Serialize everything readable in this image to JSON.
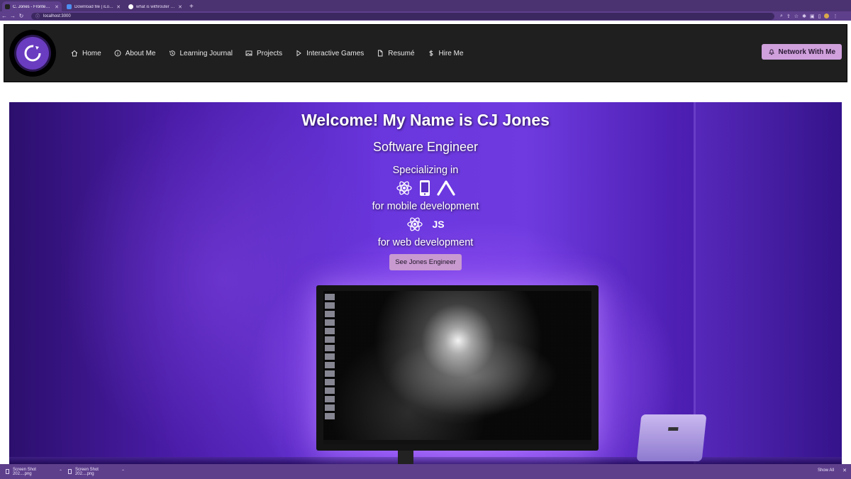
{
  "browser": {
    "tabs": [
      {
        "label": "C. Jones - Frontend & Fullstack Developer",
        "active": true
      },
      {
        "label": "Download file | iLoveIMG",
        "active": false
      },
      {
        "label": "what is withrouter - Google Search",
        "active": false
      }
    ],
    "url": "localhost:3000"
  },
  "site": {
    "nav": {
      "items": [
        {
          "label": "Home",
          "icon": "home-icon"
        },
        {
          "label": "About Me",
          "icon": "info-icon"
        },
        {
          "label": "Learning Journal",
          "icon": "history-icon"
        },
        {
          "label": "Projects",
          "icon": "image-icon"
        },
        {
          "label": "Interactive Games",
          "icon": "play-icon"
        },
        {
          "label": "Resumé",
          "icon": "document-icon"
        },
        {
          "label": "Hire Me",
          "icon": "dollar-icon"
        }
      ],
      "cta": "Network With Me"
    },
    "hero": {
      "title": "Welcome! My Name is CJ Jones",
      "subtitle": "Software Engineer",
      "specializing": "Specializing in",
      "mobile_caption": "for mobile development",
      "web_caption": "for web development",
      "js_label": "JS",
      "button": "See Jones Engineer"
    }
  },
  "downloads": {
    "items": [
      "Screen Shot 202....png",
      "Screen Shot 202....png"
    ],
    "show_all": "Show All"
  },
  "colors": {
    "browser_frame": "#4b3270",
    "nav_bg": "#1f1f1f",
    "cta_bg": "#cfa0dc",
    "hero_purple": "#6a36de"
  }
}
